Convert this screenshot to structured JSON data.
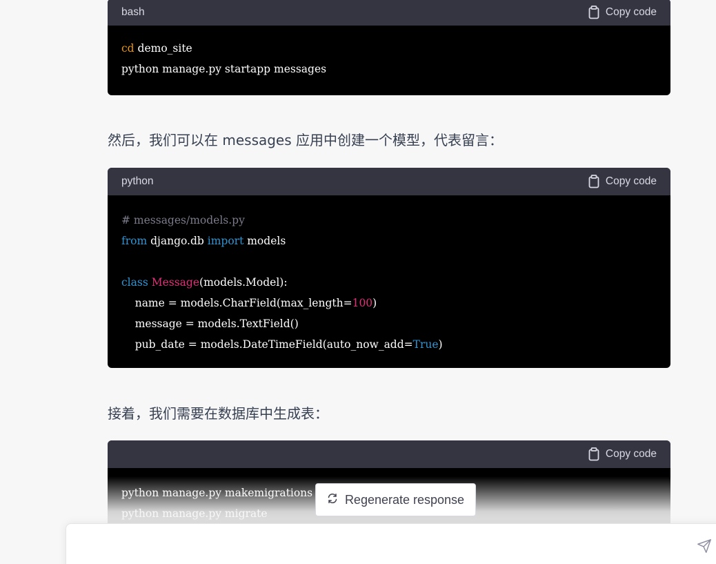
{
  "code_blocks": [
    {
      "language": "bash",
      "copy_label": "Copy code",
      "lines": [
        [
          {
            "t": "cd",
            "c": "c-orange"
          },
          {
            "t": " demo_site",
            "c": ""
          }
        ],
        [
          {
            "t": "python manage.py startapp messages",
            "c": ""
          }
        ]
      ]
    },
    {
      "language": "python",
      "copy_label": "Copy code",
      "lines": [
        [
          {
            "t": "# messages/models.py",
            "c": "c-comment"
          }
        ],
        [
          {
            "t": "from",
            "c": "c-kw"
          },
          {
            "t": " django.db ",
            "c": ""
          },
          {
            "t": "import",
            "c": "c-kw"
          },
          {
            "t": " models",
            "c": ""
          }
        ],
        [],
        [
          {
            "t": "class",
            "c": "c-kw"
          },
          {
            "t": " ",
            "c": ""
          },
          {
            "t": "Message",
            "c": "c-cls"
          },
          {
            "t": "(models.Model):",
            "c": ""
          }
        ],
        [
          {
            "t": "    name = models.CharField(max_length=",
            "c": ""
          },
          {
            "t": "100",
            "c": "c-num"
          },
          {
            "t": ")",
            "c": ""
          }
        ],
        [
          {
            "t": "    message = models.TextField()",
            "c": ""
          }
        ],
        [
          {
            "t": "    pub_date = models.DateTimeField(auto_now_add=",
            "c": ""
          },
          {
            "t": "True",
            "c": "c-bool"
          },
          {
            "t": ")",
            "c": ""
          }
        ]
      ]
    },
    {
      "language": "",
      "copy_label": "Copy code",
      "lines": [
        [
          {
            "t": "python manage.py makemigrations",
            "c": ""
          }
        ],
        [
          {
            "t": "python manage.py migrate",
            "c": ""
          }
        ]
      ]
    }
  ],
  "prose": {
    "para1": "然后，我们可以在 messages 应用中创建一个模型，代表留言：",
    "para2": "接着，我们需要在数据库中生成表："
  },
  "regenerate_label": "Regenerate response",
  "input": {
    "placeholder": ""
  },
  "colors": {
    "code_bg": "#000000",
    "header_bg": "#343541",
    "page_bg": "#f7f7f8"
  },
  "icons": {
    "copy": "clipboard-icon",
    "regen": "refresh-icon",
    "send": "send-icon"
  }
}
